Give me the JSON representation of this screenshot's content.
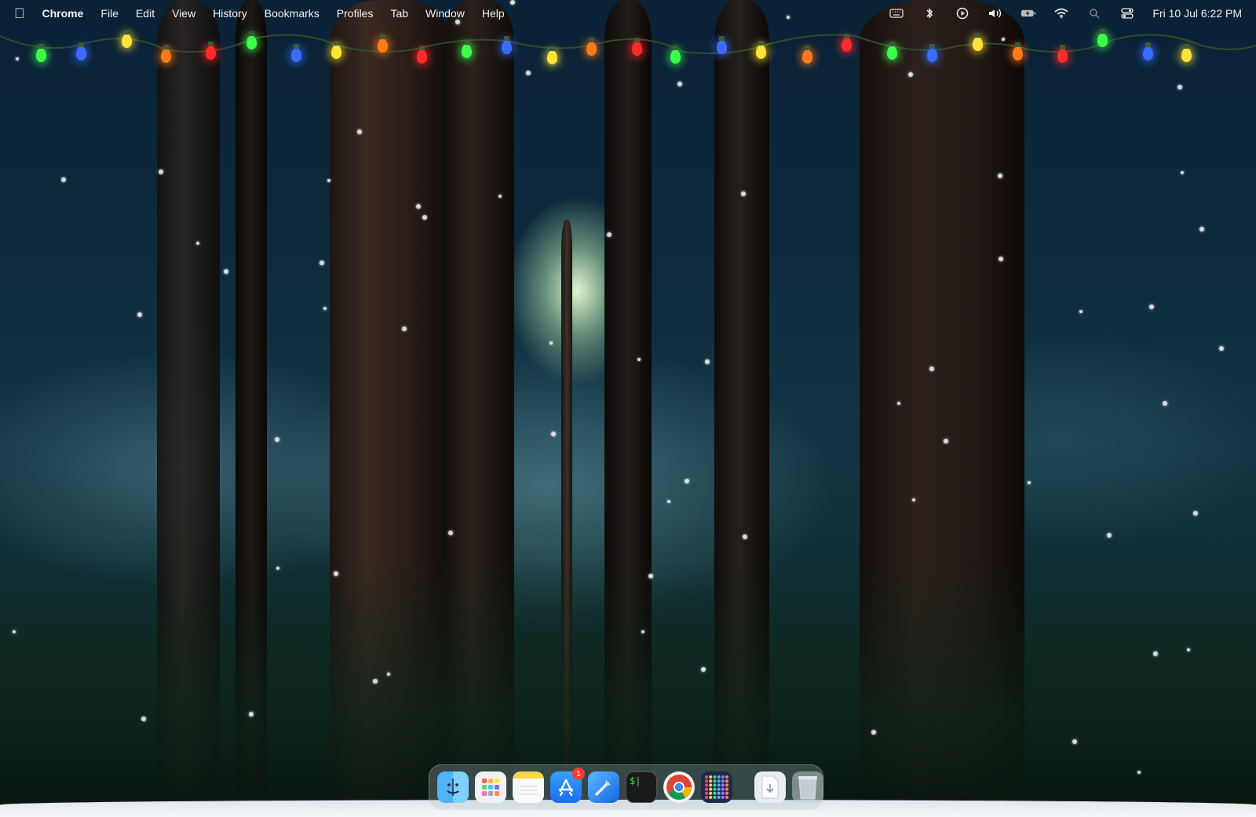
{
  "menubar": {
    "apple_icon": "apple-logo-icon",
    "app_name": "Chrome",
    "menus": [
      "File",
      "Edit",
      "View",
      "History",
      "Bookmarks",
      "Profiles",
      "Tab",
      "Window",
      "Help"
    ],
    "status_icons": [
      "keyboard-icon",
      "bluetooth-icon",
      "play-icon",
      "volume-icon",
      "battery-charging-icon",
      "wifi-icon",
      "spotlight-search-icon",
      "control-center-icon"
    ],
    "clock": "Fri 10 Jul  6:22 PM"
  },
  "dock": {
    "apps": [
      {
        "name": "Finder",
        "icon": "finder-icon",
        "running": true,
        "badge": ""
      },
      {
        "name": "Launchpad",
        "icon": "launchpad-icon",
        "running": false,
        "badge": ""
      },
      {
        "name": "Notes",
        "icon": "notes-icon",
        "running": true,
        "badge": ""
      },
      {
        "name": "App Store",
        "icon": "app-store-icon",
        "running": false,
        "badge": "1"
      },
      {
        "name": "Xcode",
        "icon": "xcode-icon",
        "running": true,
        "badge": ""
      },
      {
        "name": "Terminal",
        "icon": "terminal-icon",
        "running": true,
        "badge": ""
      },
      {
        "name": "Google Chrome",
        "icon": "chrome-icon",
        "running": true,
        "badge": ""
      },
      {
        "name": "Grid App",
        "icon": "dotted-grid-app-icon",
        "running": true,
        "badge": ""
      }
    ],
    "stack": {
      "name": "Downloads",
      "icon": "downloads-stack-icon"
    },
    "trash": {
      "name": "Trash",
      "icon": "trash-icon"
    },
    "terminal_glyph": "$|"
  },
  "colors": {
    "bulb_red": "#ff2a2a",
    "bulb_green": "#3dff4a",
    "bulb_blue": "#3c6cff",
    "bulb_yellow": "#ffe23a",
    "bulb_orange": "#ff7a1a",
    "badge": "#ff3b30"
  }
}
